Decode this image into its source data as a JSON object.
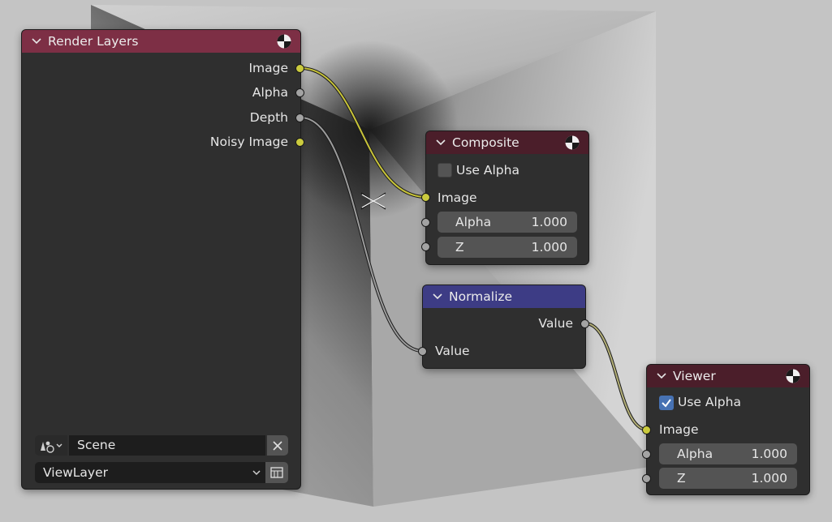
{
  "nodes": {
    "render_layers": {
      "title": "Render Layers",
      "outputs": [
        "Image",
        "Alpha",
        "Depth",
        "Noisy Image"
      ],
      "scene": "Scene",
      "view_layer": "ViewLayer"
    },
    "composite": {
      "title": "Composite",
      "use_alpha_label": "Use Alpha",
      "use_alpha_checked": false,
      "image_label": "Image",
      "fields": [
        {
          "label": "Alpha",
          "value": "1.000"
        },
        {
          "label": "Z",
          "value": "1.000"
        }
      ]
    },
    "normalize": {
      "title": "Normalize",
      "output_label": "Value",
      "input_label": "Value"
    },
    "viewer": {
      "title": "Viewer",
      "use_alpha_label": "Use Alpha",
      "use_alpha_checked": true,
      "image_label": "Image",
      "fields": [
        {
          "label": "Alpha",
          "value": "1.000"
        },
        {
          "label": "Z",
          "value": "1.000"
        }
      ]
    }
  },
  "links": [
    {
      "from": "Render Layers.Image",
      "to": "Composite.Image",
      "color": "#c8c43a"
    },
    {
      "from": "Render Layers.Depth",
      "to": "Normalize.Value",
      "color": "#9c9c9c"
    },
    {
      "from": "Normalize.Value",
      "to": "Viewer.Image",
      "color": "#b4b078"
    }
  ],
  "colors": {
    "node_body": "#2f2f2f",
    "header_output": "#7d2f45",
    "header_output_dark": "#4b1e2a",
    "header_converter": "#3d3c85",
    "socket_color": "#cbcb3e",
    "socket_float": "#a3a3a3",
    "checkbox_on": "#4772b3"
  },
  "icons": {
    "render": "render-result-icon",
    "collapse": "chevron-down-icon",
    "scene": "scene-data-icon",
    "clear": "close-icon",
    "view_layer": "view-layer-browse-icon",
    "cursor": "cut-links-cursor-icon"
  }
}
